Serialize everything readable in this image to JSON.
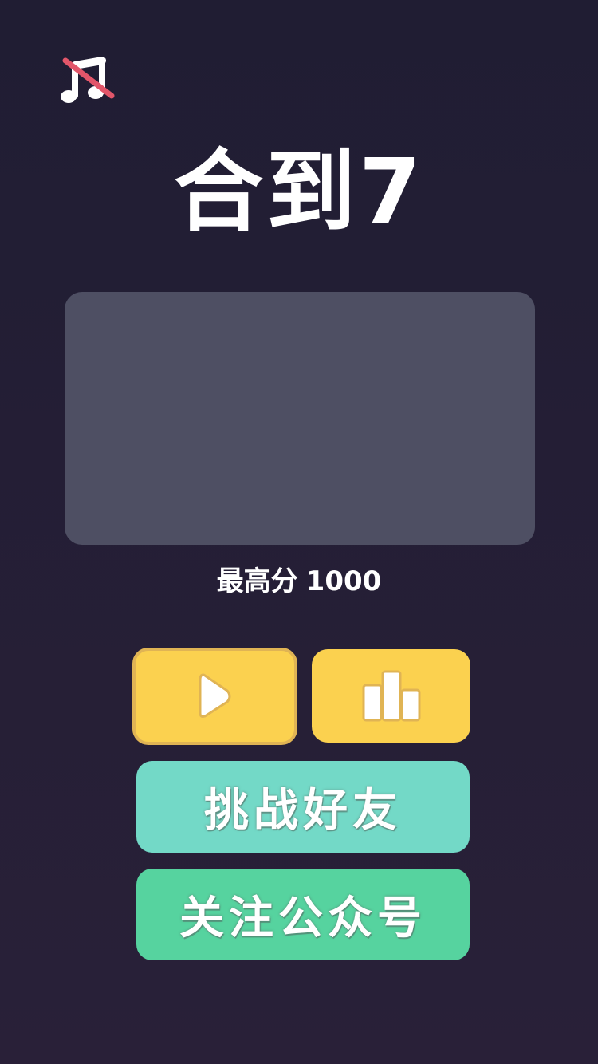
{
  "game": {
    "title": "合到7"
  },
  "best_score": {
    "label": "最高分",
    "value": "1000"
  },
  "buttons": {
    "challenge_label": "挑战好友",
    "follow_label": "关注公众号"
  },
  "icons": {
    "music": "music-muted-icon",
    "play": "play-icon",
    "rank": "leaderboard-icon"
  },
  "colors": {
    "background": "#201d33",
    "panel": "#4e4f63",
    "yellow_button": "#fbd14f",
    "challenge_button": "#73d9c7",
    "follow_button": "#56d39f",
    "mute_slash": "#e2566a"
  }
}
